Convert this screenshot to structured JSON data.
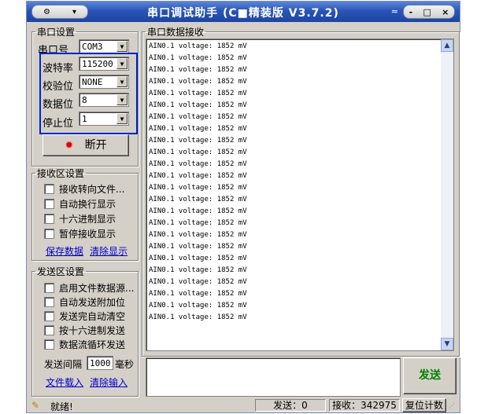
{
  "window": {
    "title": "串口调试助手 (C■精装版 V3.7.2)",
    "controls": [
      "-",
      "□",
      "×"
    ]
  },
  "serial_settings": {
    "legend": "串口设置",
    "port_label": "串口号",
    "port_value": "COM3",
    "baud_label": "波特率",
    "baud_value": "115200",
    "parity_label": "校验位",
    "parity_value": "NONE",
    "databits_label": "数据位",
    "databits_value": "8",
    "stopbits_label": "停止位",
    "stopbits_value": "1",
    "connect_button": "断开"
  },
  "receive_settings": {
    "legend": "接收区设置",
    "options": [
      "接收转向文件...",
      "自动换行显示",
      "十六进制显示",
      "暂停接收显示"
    ],
    "save_link": "保存数据",
    "clear_link": "清除显示"
  },
  "send_settings": {
    "legend": "发送区设置",
    "options": [
      "启用文件数据源...",
      "自动发送附加位",
      "发送完自动清空",
      "按十六进制发送",
      "数据流循环发送"
    ],
    "interval_label": "发送间隔",
    "interval_value": "1000",
    "interval_unit": "毫秒",
    "load_link": "文件载入",
    "clear_link": "清除输入"
  },
  "receive_area": {
    "legend": "串口数据接收",
    "lines": [
      "AIN0.1 voltage: 1852 mV",
      "AIN0.1 voltage: 1852 mV",
      "AIN0.1 voltage: 1852 mV",
      "AIN0.1 voltage: 1852 mV",
      "AIN0.1 voltage: 1852 mV",
      "AIN0.1 voltage: 1852 mV",
      "AIN0.1 voltage: 1852 mV",
      "AIN0.1 voltage: 1852 mV",
      "AIN0.1 voltage: 1852 mV",
      "AIN0.1 voltage: 1852 mV",
      "AIN0.1 voltage: 1852 mV",
      "AIN0.1 voltage: 1852 mV",
      "AIN0.1 voltage: 1852 mV",
      "AIN0.1 voltage: 1852 mV",
      "AIN0.1 voltage: 1852 mV",
      "AIN0.1 voltage: 1852 mV",
      "AIN0.1 voltage: 1852 mV",
      "AIN0.1 voltage: 1852 mV",
      "AIN0.1 voltage: 1852 mV",
      "AIN0.1 voltage: 1852 mV",
      "AIN0.1 voltage: 1852 mV",
      "AIN0.1 voltage: 1852 mV",
      "AIN0.1 voltage: 1852 mV",
      "AIN0.1 voltage: 1852 mV"
    ]
  },
  "send_button": "发送",
  "status": {
    "ready": "就绪!",
    "sent": "发送：0",
    "received": "接收：342975",
    "reset_button": "复位计数"
  },
  "colors": {
    "send_label": "#008000",
    "highlight_frame": "#0022cc",
    "led": "#e00000"
  }
}
